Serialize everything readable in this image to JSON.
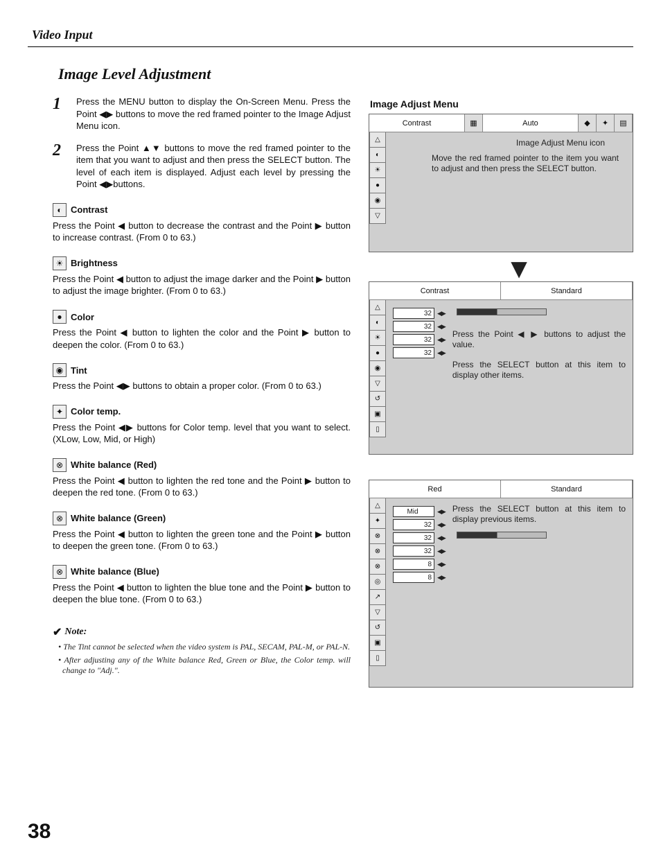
{
  "section_header": "Video Input",
  "title": "Image Level Adjustment",
  "steps": [
    {
      "num": "1",
      "text": "Press the MENU button to display the On-Screen Menu.  Press the Point ◀▶ buttons to move the red framed pointer to the Image Adjust Menu icon."
    },
    {
      "num": "2",
      "text": "Press the Point ▲▼ buttons to move the red framed pointer to the item that you want to adjust and then press the SELECT button.  The level of each item is displayed.  Adjust each level by pressing the Point ◀▶buttons."
    }
  ],
  "items": [
    {
      "icon": "◐",
      "label": "Contrast",
      "desc": "Press the Point ◀ button to decrease the contrast and the Point ▶ button to increase contrast.  (From 0 to 63.)"
    },
    {
      "icon": "☀",
      "label": "Brightness",
      "desc": "Press the Point ◀ button to adjust the image darker and the Point ▶ button to adjust the image brighter.  (From 0 to 63.)"
    },
    {
      "icon": "●",
      "label": "Color",
      "desc": "Press the Point ◀ button to lighten the color and the Point ▶ button to deepen the color.  (From 0 to 63.)"
    },
    {
      "icon": "◉",
      "label": "Tint",
      "desc": "Press the Point ◀▶ buttons to obtain a proper color.  (From 0 to 63.)"
    },
    {
      "icon": "✦",
      "label": "Color temp.",
      "desc": "Press the Point ◀▶ buttons for Color temp. level that you want to select. (XLow, Low, Mid, or High)"
    },
    {
      "icon": "⊗",
      "label": "White balance (Red)",
      "desc": "Press the Point ◀ button to lighten the red tone and the Point ▶ button to deepen the red tone.  (From 0 to 63.)"
    },
    {
      "icon": "⊗",
      "label": "White balance (Green)",
      "desc": "Press the Point ◀ button to lighten the green tone and the Point ▶ button to deepen the green tone.  (From 0 to 63.)"
    },
    {
      "icon": "⊗",
      "label": "White balance (Blue)",
      "desc": "Press the Point ◀ button to lighten the blue tone and the Point ▶ button to deepen the blue tone.  (From 0 to 63.)"
    }
  ],
  "note": {
    "heading": "Note:",
    "items": [
      "The Tint cannot be selected when the video system is PAL, SECAM, PAL-M, or PAL-N.",
      "After adjusting any of the White balance Red, Green or Blue, the Color temp. will change to \"Adj.\"."
    ]
  },
  "right": {
    "title": "Image Adjust Menu",
    "panel1": {
      "top_left": "Contrast",
      "top_right": "Auto",
      "icon_label": "Image Adjust Menu icon",
      "callout": "Move the red framed pointer to the item you want to adjust and then press the SELECT button."
    },
    "panel2": {
      "top_left": "Contrast",
      "top_right": "Standard",
      "rows": [
        "32",
        "32",
        "32",
        "32"
      ],
      "callout1": "Press the Point ◀ ▶ buttons to adjust the value.",
      "callout2": "Press the SELECT button at this item to display other items."
    },
    "panel3": {
      "top_left": "Red",
      "top_right": "Standard",
      "rows": [
        "Mid",
        "32",
        "32",
        "32",
        "8",
        "8"
      ],
      "callout": "Press the SELECT button at this item to display previous items."
    }
  },
  "page_number": "38"
}
